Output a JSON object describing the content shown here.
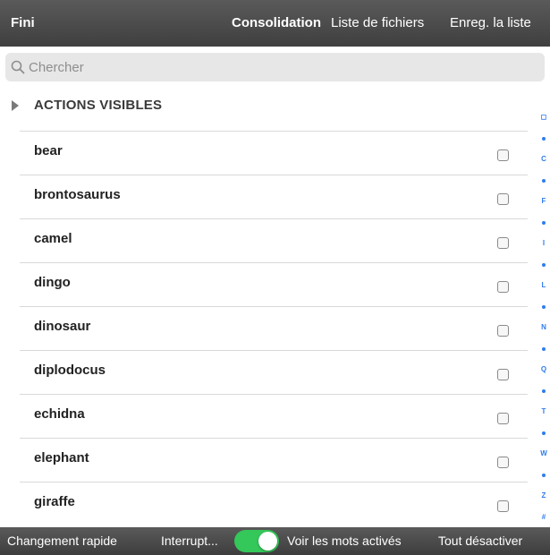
{
  "topbar": {
    "done_label": "Fini",
    "consolidation_label": "Consolidation",
    "files_label": "Liste de fichiers",
    "save_label": "Enreg. la liste"
  },
  "search": {
    "placeholder": "Chercher",
    "value": ""
  },
  "section": {
    "label": "ACTIONS VISIBLES",
    "expanded": false
  },
  "items": [
    {
      "label": "bear",
      "checked": false
    },
    {
      "label": "brontosaurus",
      "checked": false
    },
    {
      "label": "camel",
      "checked": false
    },
    {
      "label": "dingo",
      "checked": false
    },
    {
      "label": "dinosaur",
      "checked": false
    },
    {
      "label": "diplodocus",
      "checked": false
    },
    {
      "label": "echidna",
      "checked": false
    },
    {
      "label": "elephant",
      "checked": false
    },
    {
      "label": "giraffe",
      "checked": false
    }
  ],
  "index": {
    "entries": [
      "◻",
      "•",
      "C",
      "•",
      "F",
      "•",
      "I",
      "•",
      "L",
      "•",
      "N",
      "•",
      "Q",
      "•",
      "T",
      "•",
      "W",
      "•",
      "Z",
      "#"
    ]
  },
  "bottombar": {
    "quick_change_label": "Changement rapide",
    "interrupt_label": "Interrupt...",
    "interrupt_toggle_on": true,
    "show_active_label": "Voir les mots activés",
    "disable_all_label": "Tout désactiver"
  },
  "colors": {
    "bar": "#4a4a4a",
    "accent": "#2f7cf0",
    "toggle_on": "#34c759"
  }
}
